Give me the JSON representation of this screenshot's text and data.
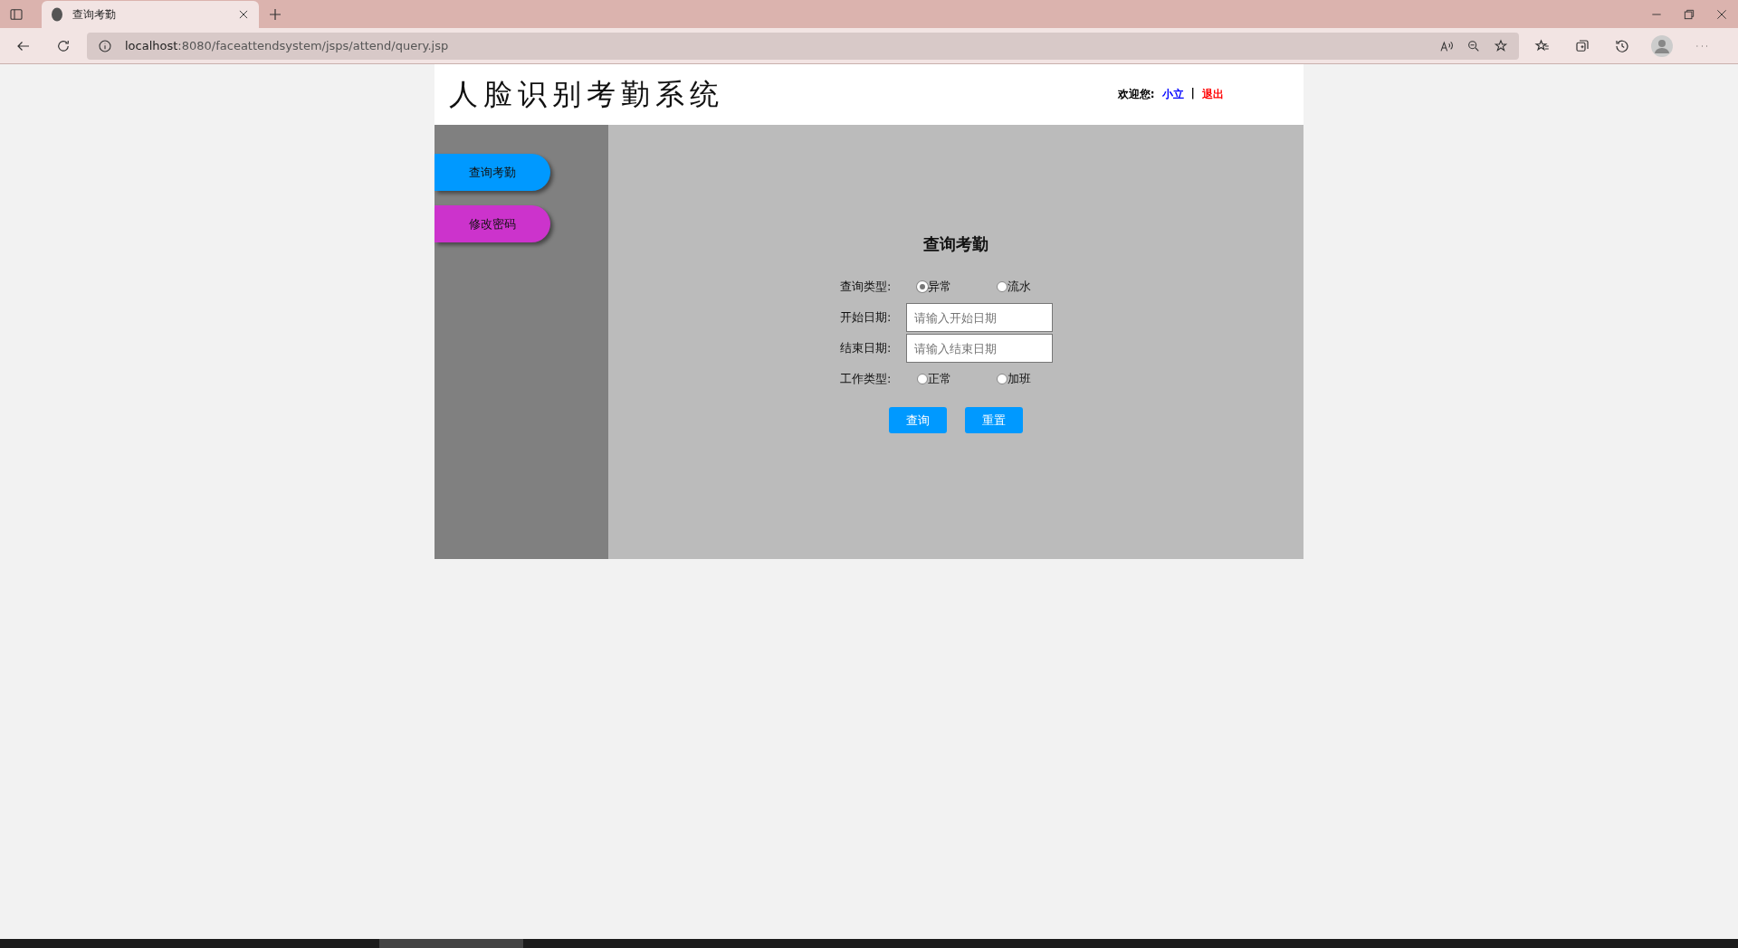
{
  "browser": {
    "tabs": [
      {
        "title": "查询考勤",
        "selected": true
      }
    ],
    "address": {
      "host": "localhost",
      "path": ":8080/faceattendsystem/jsps/attend/query.jsp"
    }
  },
  "header": {
    "title": "人脸识别考勤系统",
    "welcome": "欢迎您:",
    "user": "小立",
    "separator": "|",
    "logout": "退出"
  },
  "sidebar": {
    "items": [
      {
        "label": "查询考勤",
        "color": "#0099ff"
      },
      {
        "label": "修改密码",
        "color": "#cc33cc"
      }
    ]
  },
  "form": {
    "title": "查询考勤",
    "rows": [
      {
        "kind": "radio",
        "label": "查询类型:",
        "options": [
          {
            "label": "异常",
            "selected": true
          },
          {
            "label": "流水",
            "selected": false
          }
        ]
      },
      {
        "kind": "text",
        "label": "开始日期:",
        "placeholder": "请输入开始日期"
      },
      {
        "kind": "text",
        "label": "结束日期:",
        "placeholder": "请输入结束日期"
      },
      {
        "kind": "radio",
        "label": "工作类型:",
        "options": [
          {
            "label": "正常",
            "selected": false
          },
          {
            "label": "加班",
            "selected": false
          }
        ]
      }
    ],
    "buttons": [
      "查询",
      "重置"
    ]
  }
}
